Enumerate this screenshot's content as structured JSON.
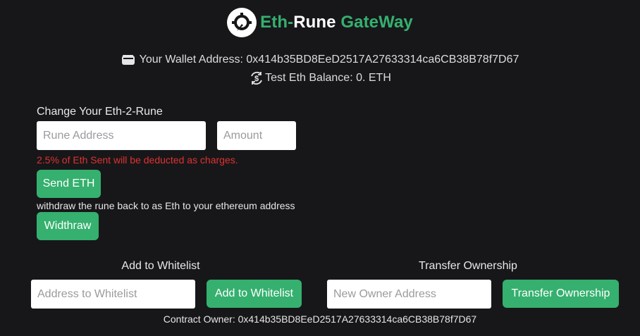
{
  "header": {
    "title_part1": "Eth-",
    "title_part2": "Rune",
    "title_part3": " GateWay",
    "logo_icon": "shield-logo-icon"
  },
  "wallet": {
    "address_label": "Your Wallet Address: 0x414b35BD8EeD2517A27633314ca6CB38B78f7D67",
    "balance_label": "Test Eth Balance: 0. ETH",
    "wallet_icon": "wallet-icon",
    "balance_icon": "exchange-dollar-icon"
  },
  "exchange": {
    "heading": "Change Your Eth-2-Rune",
    "rune_address_placeholder": "Rune Address",
    "amount_placeholder": "Amount",
    "warning": "2.5% of Eth Sent will be deducted as charges.",
    "send_label": "Send ETH",
    "withdraw_note": "withdraw the rune back to as Eth to your ethereum address",
    "withdraw_label": "Widthraw"
  },
  "whitelist": {
    "heading": "Add to Whitelist",
    "placeholder": "Address to Whitelist",
    "button_label": "Add to Whitelist"
  },
  "ownership": {
    "heading": "Transfer Ownership",
    "placeholder": "New Owner Address",
    "button_label": "Transfer Ownership"
  },
  "footer": {
    "contract_owner": "Contract Owner: 0x414b35BD8EeD2517A27633314ca6CB38B78f7D67"
  },
  "colors": {
    "background": "#17171a",
    "accent": "#35b06e",
    "warning": "#e0322f"
  }
}
